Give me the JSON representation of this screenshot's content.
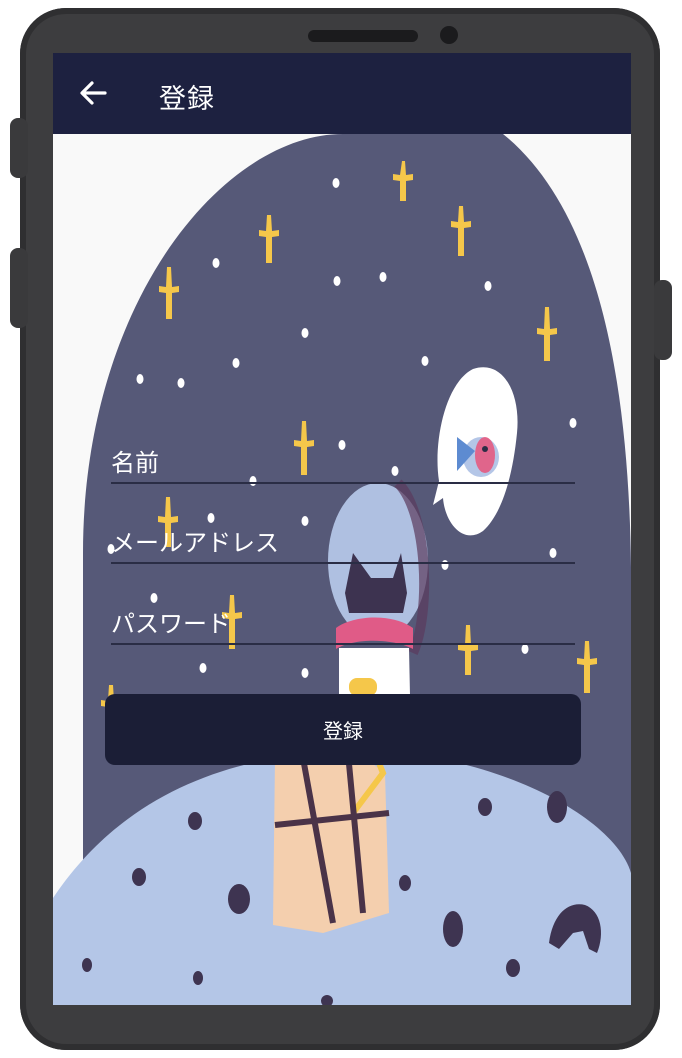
{
  "header": {
    "back_icon": "arrow-left-icon",
    "title": "登録"
  },
  "form": {
    "fields": [
      {
        "label": "名前"
      },
      {
        "label": "メールアドレス"
      },
      {
        "label": "パスワード"
      }
    ],
    "submit_label": "登録"
  },
  "colors": {
    "appbar": "#1d2140",
    "night_sky": "#565978",
    "planet": "#b4c6e7",
    "star_gold": "#f5c74a",
    "button": "#1b1e36"
  }
}
